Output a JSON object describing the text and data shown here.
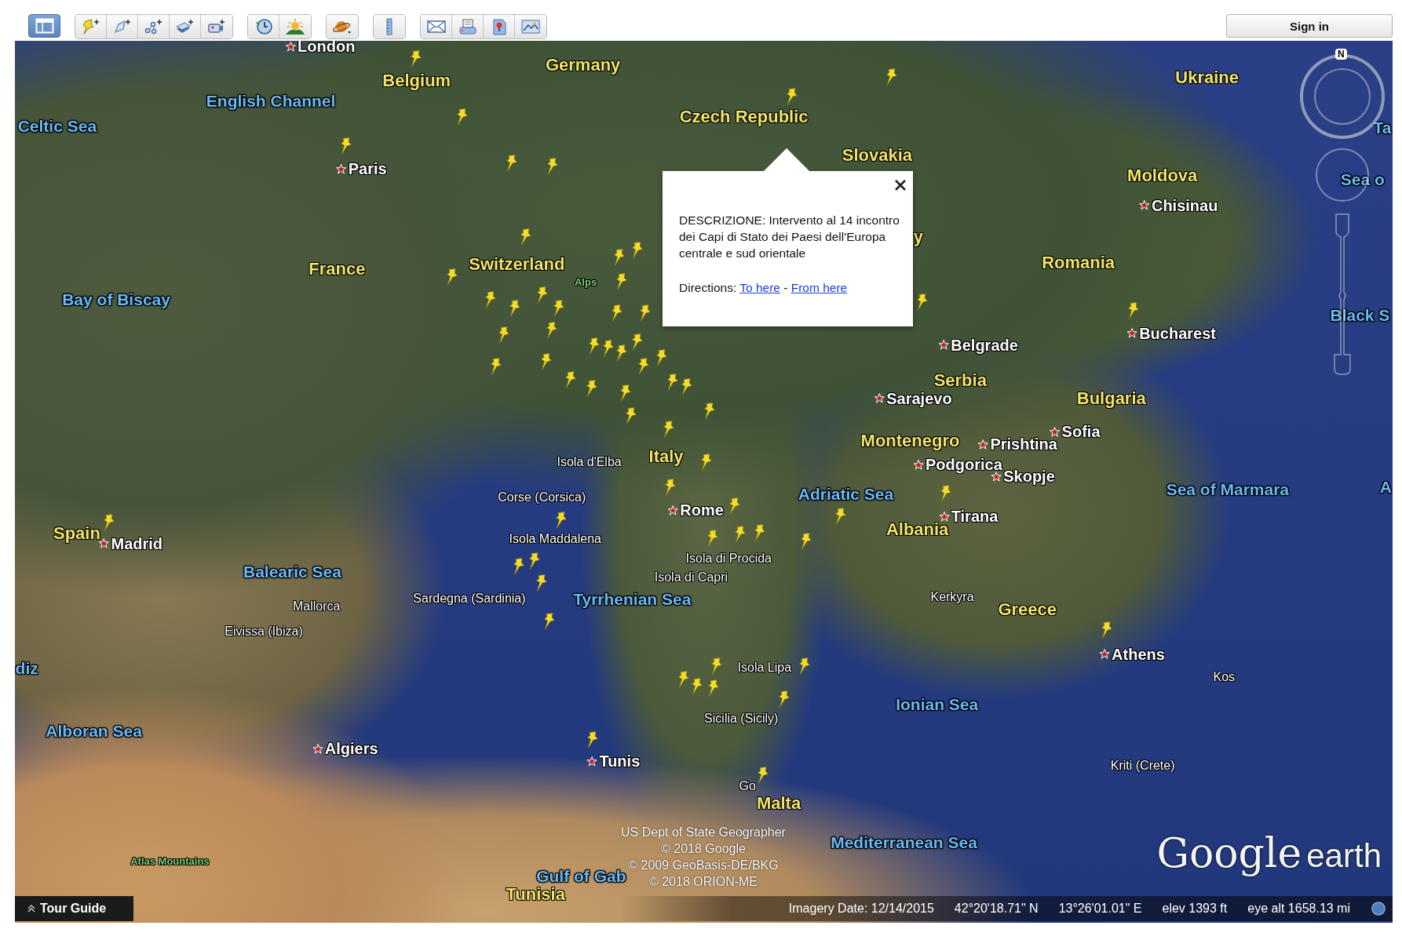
{
  "toolbar": {
    "sidebar_toggle": {
      "on": true
    },
    "sign_in": "Sign in"
  },
  "map": {
    "labels": [
      {
        "text": "London",
        "kind": "city"
      },
      {
        "text": "Belgium",
        "kind": "country"
      },
      {
        "text": "Germany",
        "kind": "country"
      },
      {
        "text": "English Channel",
        "kind": "sea"
      },
      {
        "text": "Celtic Sea",
        "kind": "sea"
      },
      {
        "text": "Czech Republic",
        "kind": "country"
      },
      {
        "text": "Slovakia",
        "kind": "country"
      },
      {
        "text": "Ukraine",
        "kind": "country"
      },
      {
        "text": "Paris",
        "kind": "city"
      },
      {
        "text": "Moldova",
        "kind": "country"
      },
      {
        "text": "Chisinau",
        "kind": "city"
      },
      {
        "text": "Ta",
        "kind": "sea"
      },
      {
        "text": "Sea o",
        "kind": "sea"
      },
      {
        "text": "France",
        "kind": "country"
      },
      {
        "text": "Switzerland",
        "kind": "country"
      },
      {
        "text": "Alps",
        "kind": "mountain"
      },
      {
        "text": "Bay of Biscay",
        "kind": "sea"
      },
      {
        "text": "y",
        "kind": "country"
      },
      {
        "text": "Romania",
        "kind": "country"
      },
      {
        "text": "Belgrade",
        "kind": "city"
      },
      {
        "text": "Bucharest",
        "kind": "city"
      },
      {
        "text": "Black S",
        "kind": "sea"
      },
      {
        "text": "Serbia",
        "kind": "country"
      },
      {
        "text": "Sarajevo",
        "kind": "city"
      },
      {
        "text": "Bulgaria",
        "kind": "country"
      },
      {
        "text": "Montenegro",
        "kind": "country"
      },
      {
        "text": "Prishtina",
        "kind": "city"
      },
      {
        "text": "Sofia",
        "kind": "city"
      },
      {
        "text": "Isola d'Elba",
        "kind": "place"
      },
      {
        "text": "Italy",
        "kind": "country"
      },
      {
        "text": "Podgorica",
        "kind": "city"
      },
      {
        "text": "Skopje",
        "kind": "city"
      },
      {
        "text": "Corse (Corsica)",
        "kind": "place"
      },
      {
        "text": "Adriatic Sea",
        "kind": "sea"
      },
      {
        "text": "Sea of Marmara",
        "kind": "sea"
      },
      {
        "text": "A",
        "kind": "sea"
      },
      {
        "text": "Rome",
        "kind": "city"
      },
      {
        "text": "Tirana",
        "kind": "city"
      },
      {
        "text": "Spain",
        "kind": "country"
      },
      {
        "text": "Madrid",
        "kind": "city"
      },
      {
        "text": "Isola Maddalena",
        "kind": "place"
      },
      {
        "text": "Albania",
        "kind": "country"
      },
      {
        "text": "Isola di Procida",
        "kind": "place"
      },
      {
        "text": "Isola di Capri",
        "kind": "place"
      },
      {
        "text": "Balearic Sea",
        "kind": "sea"
      },
      {
        "text": "Sardegna (Sardinia)",
        "kind": "place"
      },
      {
        "text": "Tyrrhenian Sea",
        "kind": "sea"
      },
      {
        "text": "Kerkyra",
        "kind": "place"
      },
      {
        "text": "Mallorca",
        "kind": "place"
      },
      {
        "text": "Greece",
        "kind": "country"
      },
      {
        "text": "Eivissa (Ibiza)",
        "kind": "place"
      },
      {
        "text": "Athens",
        "kind": "city"
      },
      {
        "text": "diz",
        "kind": "sea"
      },
      {
        "text": "Isola Lipa",
        "kind": "place"
      },
      {
        "text": "Kos",
        "kind": "place"
      },
      {
        "text": "Ionian Sea",
        "kind": "sea"
      },
      {
        "text": "Sicilia (Sicily)",
        "kind": "place"
      },
      {
        "text": "Alboran Sea",
        "kind": "sea"
      },
      {
        "text": "Algiers",
        "kind": "city"
      },
      {
        "text": "Tunis",
        "kind": "city"
      },
      {
        "text": "Kriti (Crete)",
        "kind": "place"
      },
      {
        "text": "Go",
        "kind": "place"
      },
      {
        "text": "Malta",
        "kind": "country"
      },
      {
        "text": "Mediterranean Sea",
        "kind": "sea"
      },
      {
        "text": "Atlas Mountains",
        "kind": "mountain"
      },
      {
        "text": "Gulf of Gab",
        "kind": "sea"
      },
      {
        "text": "Tunisia",
        "kind": "country"
      }
    ],
    "attribution": [
      "US Dept of State Geographer",
      "© 2018 Google",
      "© 2009 GeoBasis-DE/BKG",
      "© 2018 ORION-ME"
    ],
    "logo": {
      "brand": "Google",
      "product": "earth"
    }
  },
  "navigation": {
    "north_label": "N"
  },
  "popup": {
    "description": "DESCRIZIONE: Intervento al 14 incontro dei Capi di Stato dei Paesi dell'Europa centrale e sud orientale",
    "directions_label": "Directions:",
    "links": [
      "To here",
      "From here"
    ],
    "separator": "-"
  },
  "tour_guide": {
    "label": "Tour Guide"
  },
  "status_bar": {
    "imagery_date": "Imagery Date: 12/14/2015",
    "latitude": "42°20'18.71\" N",
    "longitude": "13°26'01.01\" E",
    "elevation": "elev 1393 ft",
    "eye_altitude": "eye alt 1658.13 mi"
  }
}
